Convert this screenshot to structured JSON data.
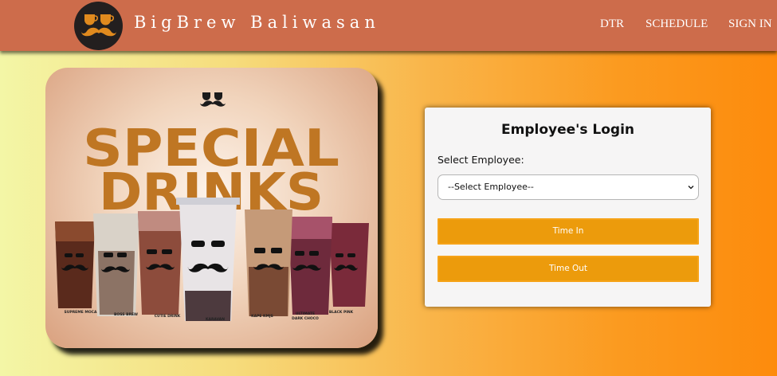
{
  "header": {
    "brand": "BigBrew Baliwasan",
    "nav": {
      "dtr": "DTR",
      "schedule": "SCHEDULE",
      "signin": "SIGN IN"
    }
  },
  "promo": {
    "headline_1": "SPECIAL",
    "headline_2": "DRINKS",
    "drinks": [
      "SUPREME MOCA",
      "BOSS BREW",
      "CUTIE DRINK",
      "KARAVAN",
      "KAPE KMJS",
      "ULTIMATE",
      "DARK CHOCO",
      "BLACK PINK"
    ]
  },
  "login": {
    "title": "Employee's Login",
    "select_label": "Select Employee:",
    "select_value": "--Select Employee--",
    "time_in": "Time In",
    "time_out": "Time Out"
  },
  "colors": {
    "header": "#cd6c4b",
    "button": "#ec9b0c",
    "headline": "#bf7623"
  }
}
